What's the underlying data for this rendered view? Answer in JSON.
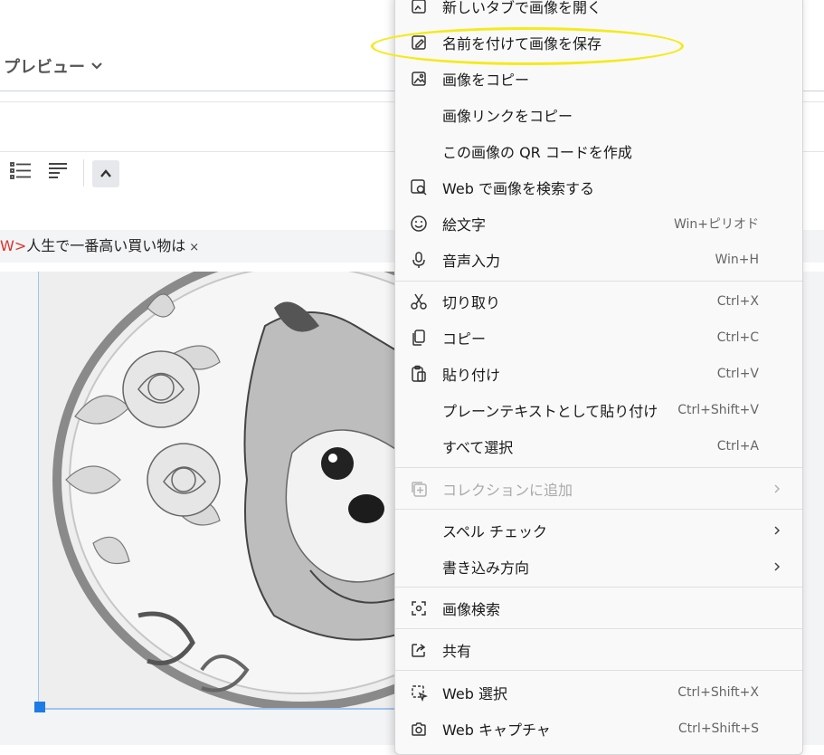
{
  "editor": {
    "preview_label": "プレビュー",
    "title_tag": "W>",
    "title_text": "人生で一番高い買い物は",
    "title_remove": "×"
  },
  "icons": {
    "list": "list-icon",
    "align": "align-icon",
    "collapse": "chevron-up-icon"
  },
  "context_menu": {
    "items": [
      {
        "id": "open-new-tab",
        "label": "新しいタブで画像を開く",
        "shortcut": "",
        "icon": "image-tab-icon"
      },
      {
        "id": "save-image-as",
        "label": "名前を付けて画像を保存",
        "shortcut": "",
        "icon": "save-image-icon"
      },
      {
        "id": "copy-image",
        "label": "画像をコピー",
        "shortcut": "",
        "icon": "image-icon"
      },
      {
        "id": "copy-image-link",
        "label": "画像リンクをコピー",
        "shortcut": "",
        "icon": ""
      },
      {
        "id": "create-qr",
        "label": "この画像の QR コードを作成",
        "shortcut": "",
        "icon": ""
      },
      {
        "id": "search-web",
        "label": "Web で画像を検索する",
        "shortcut": "",
        "icon": "image-search-icon"
      },
      {
        "id": "emoji",
        "label": "絵文字",
        "shortcut": "Win+ピリオド",
        "icon": "emoji-icon"
      },
      {
        "id": "voice-input",
        "label": "音声入力",
        "shortcut": "Win+H",
        "icon": "microphone-icon"
      },
      {
        "id": "cut",
        "label": "切り取り",
        "shortcut": "Ctrl+X",
        "icon": "scissors-icon"
      },
      {
        "id": "copy",
        "label": "コピー",
        "shortcut": "Ctrl+C",
        "icon": "copy-icon"
      },
      {
        "id": "paste",
        "label": "貼り付け",
        "shortcut": "Ctrl+V",
        "icon": "paste-icon"
      },
      {
        "id": "paste-plain",
        "label": "プレーンテキストとして貼り付け",
        "shortcut": "Ctrl+Shift+V",
        "icon": ""
      },
      {
        "id": "select-all",
        "label": "すべて選択",
        "shortcut": "Ctrl+A",
        "icon": ""
      },
      {
        "id": "add-collection",
        "label": "コレクションに追加",
        "shortcut": "",
        "icon": "collection-add-icon"
      },
      {
        "id": "spell-check",
        "label": "スペル チェック",
        "shortcut": "",
        "icon": ""
      },
      {
        "id": "writing-direction",
        "label": "書き込み方向",
        "shortcut": "",
        "icon": ""
      },
      {
        "id": "visual-search",
        "label": "画像検索",
        "shortcut": "",
        "icon": "visual-search-icon"
      },
      {
        "id": "share",
        "label": "共有",
        "shortcut": "",
        "icon": "share-icon"
      },
      {
        "id": "web-select",
        "label": "Web 選択",
        "shortcut": "Ctrl+Shift+X",
        "icon": "web-select-icon"
      },
      {
        "id": "web-capture",
        "label": "Web キャプチャ",
        "shortcut": "Ctrl+Shift+S",
        "icon": "web-capture-icon"
      }
    ]
  }
}
